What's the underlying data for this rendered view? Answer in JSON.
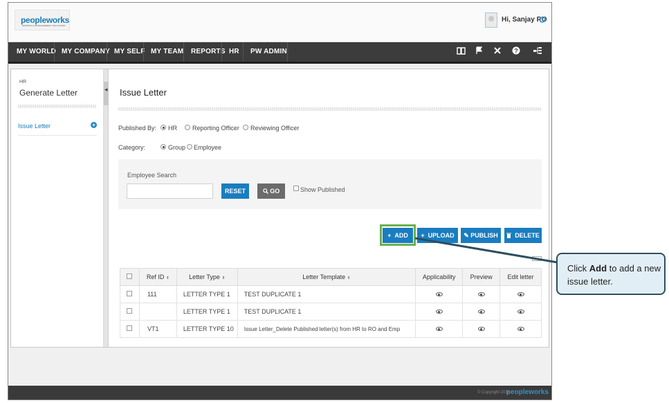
{
  "header": {
    "logo": "peopleworks",
    "logo_sub": "GROWTH & ENGAGEMENT SOLUTIONS",
    "greeting": "Hi, Sanjay RO"
  },
  "nav": {
    "items": [
      "MY WORLD",
      "MY COMPANY",
      "MY SELF",
      "MY TEAM",
      "REPORTS",
      "HR",
      "PW ADMIN"
    ],
    "icons": [
      "book-icon",
      "flag-icon",
      "tools-icon",
      "help-icon",
      "sitemap-icon"
    ]
  },
  "sidebar": {
    "section": "HR",
    "title": "Generate Letter",
    "items": [
      {
        "label": "Issue Letter"
      }
    ]
  },
  "main": {
    "title": "Issue Letter",
    "published_by_label": "Published By:",
    "published_by_options": [
      "HR",
      "Reporting Officer",
      "Reviewing Officer"
    ],
    "published_by_selected": "HR",
    "category_label": "Category:",
    "category_options": [
      "Group",
      "Employee"
    ],
    "category_selected": "Group",
    "search": {
      "label": "Employee Search",
      "value": "",
      "reset_label": "RESET",
      "go_label": "GO",
      "show_published_label": "Show Published"
    },
    "actions": {
      "add": "ADD",
      "upload": "UPLOAD",
      "publish": "PUBLISH",
      "delete": "DELETE"
    },
    "table": {
      "columns": [
        "Ref ID",
        "Letter Type",
        "Letter Template",
        "Applicability",
        "Preview",
        "Edit letter"
      ],
      "rows": [
        {
          "ref_id": "111",
          "letter_type": "LETTER TYPE 1",
          "template": "TEST DUPLICATE 1"
        },
        {
          "ref_id": "",
          "letter_type": "LETTER TYPE 1",
          "template": "TEST DUPLICATE 1"
        },
        {
          "ref_id": "VT1",
          "letter_type": "LETTER TYPE 10",
          "template": "Issue Letter_Delete Published letter(s) from HR to RO and Emp"
        }
      ]
    }
  },
  "footer": {
    "copyright": "© Copyright 2015",
    "logo": "peopleworks"
  },
  "callout": {
    "pre": "Click ",
    "bold": "Add",
    "post": " to add a new issue letter."
  },
  "colors": {
    "primary_blue": "#1a7dc0",
    "nav_bg": "#3c3c3c",
    "highlight_green": "#6ab04c",
    "callout_bg": "#e2eef5"
  }
}
